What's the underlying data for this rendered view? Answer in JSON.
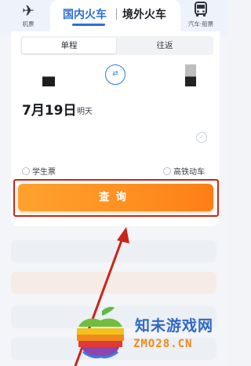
{
  "topbar": {
    "left_tab": {
      "label": "机票",
      "icon": "airplane-icon"
    },
    "tabs": [
      {
        "label": "国内火车",
        "active": true
      },
      {
        "label": "境外火车",
        "active": false
      }
    ],
    "right_tab": {
      "label": "汽车·船票",
      "icon": "bus-icon"
    }
  },
  "trip_toggle": {
    "one_way": "单程",
    "round_trip": "往返"
  },
  "date": {
    "value": "7月19日",
    "relative": "明天"
  },
  "options": {
    "student": "学生票",
    "high_speed": "高铁动车"
  },
  "search_button": {
    "label": "查询"
  },
  "watermark": {
    "title": "知未游戏网",
    "url": "ZMO28.CN"
  },
  "colors": {
    "accent": "#2a6fdb",
    "search_orange": "#ff8f1f",
    "annotation_red": "#c9251b"
  }
}
